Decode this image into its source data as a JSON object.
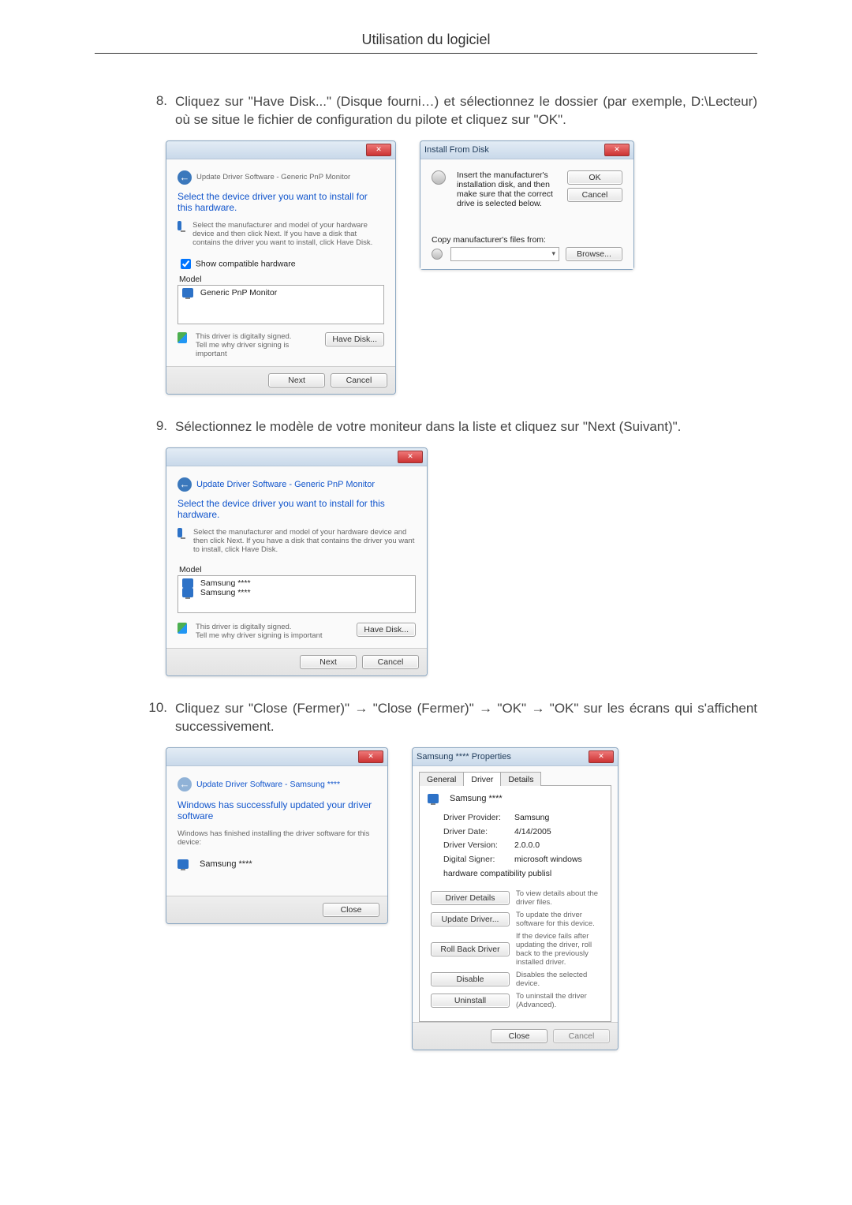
{
  "header_title": "Utilisation du logiciel",
  "step8": {
    "num": "8.",
    "text": "Cliquez sur \"Have Disk...\" (Disque fourni…) et sélectionnez le dossier (par exemple, D:\\Lecteur) où se situe le fichier de configuration du pilote et cliquez sur \"OK\"."
  },
  "step9": {
    "num": "9.",
    "text": "Sélectionnez le modèle de votre moniteur dans la liste et cliquez sur \"Next (Suivant)\"."
  },
  "step10": {
    "num": "10.",
    "text": "Cliquez sur \"Close (Fermer)\" → \"Close (Fermer)\" → \"OK\" → \"OK\" sur les écrans qui s'affichent successivement."
  },
  "update_driver1": {
    "breadcrumb": "Update Driver Software - Generic PnP Monitor",
    "headline": "Select the device driver you want to install for this hardware.",
    "hint": "Select the manufacturer and model of your hardware device and then click Next. If you have a disk that contains the driver you want to install, click Have Disk.",
    "show_compat": "Show compatible hardware",
    "col_model": "Model",
    "list_item": "Generic PnP Monitor",
    "signed_line": "This driver is digitally signed.",
    "tell_why": "Tell me why driver signing is important",
    "have_disk": "Have Disk...",
    "next": "Next",
    "cancel": "Cancel"
  },
  "install_disk": {
    "title": "Install From Disk",
    "msg": "Insert the manufacturer's installation disk, and then make sure that the correct drive is selected below.",
    "copy_from": "Copy manufacturer's files from:",
    "ok": "OK",
    "cancel": "Cancel",
    "browse": "Browse..."
  },
  "update_driver2": {
    "breadcrumb": "Update Driver Software - Generic PnP Monitor",
    "headline": "Select the device driver you want to install for this hardware.",
    "hint": "Select the manufacturer and model of your hardware device and then click Next. If you have a disk that contains the driver you want to install, click Have Disk.",
    "col_model": "Model",
    "item1": "Samsung ****",
    "item2": "Samsung ****",
    "signed_line": "This driver is digitally signed.",
    "tell_why": "Tell me why driver signing is important",
    "have_disk": "Have Disk...",
    "next": "Next",
    "cancel": "Cancel"
  },
  "success": {
    "breadcrumb": "Update Driver Software - Samsung ****",
    "headline": "Windows has successfully updated your driver software",
    "sub": "Windows has finished installing the driver software for this device:",
    "device": "Samsung ****",
    "close": "Close"
  },
  "properties": {
    "title": "Samsung **** Properties",
    "tab_general": "General",
    "tab_driver": "Driver",
    "tab_details": "Details",
    "device_name": "Samsung ****",
    "lbl_provider": "Driver Provider:",
    "val_provider": "Samsung",
    "lbl_date": "Driver Date:",
    "val_date": "4/14/2005",
    "lbl_version": "Driver Version:",
    "val_version": "2.0.0.0",
    "lbl_signer": "Digital Signer:",
    "val_signer": "microsoft windows hardware compatibility publisl",
    "btn_details": "Driver Details",
    "desc_details": "To view details about the driver files.",
    "btn_update": "Update Driver...",
    "desc_update": "To update the driver software for this device.",
    "btn_rollback": "Roll Back Driver",
    "desc_rollback": "If the device fails after updating the driver, roll back to the previously installed driver.",
    "btn_disable": "Disable",
    "desc_disable": "Disables the selected device.",
    "btn_uninstall": "Uninstall",
    "desc_uninstall": "To uninstall the driver (Advanced).",
    "close": "Close",
    "cancel": "Cancel"
  }
}
